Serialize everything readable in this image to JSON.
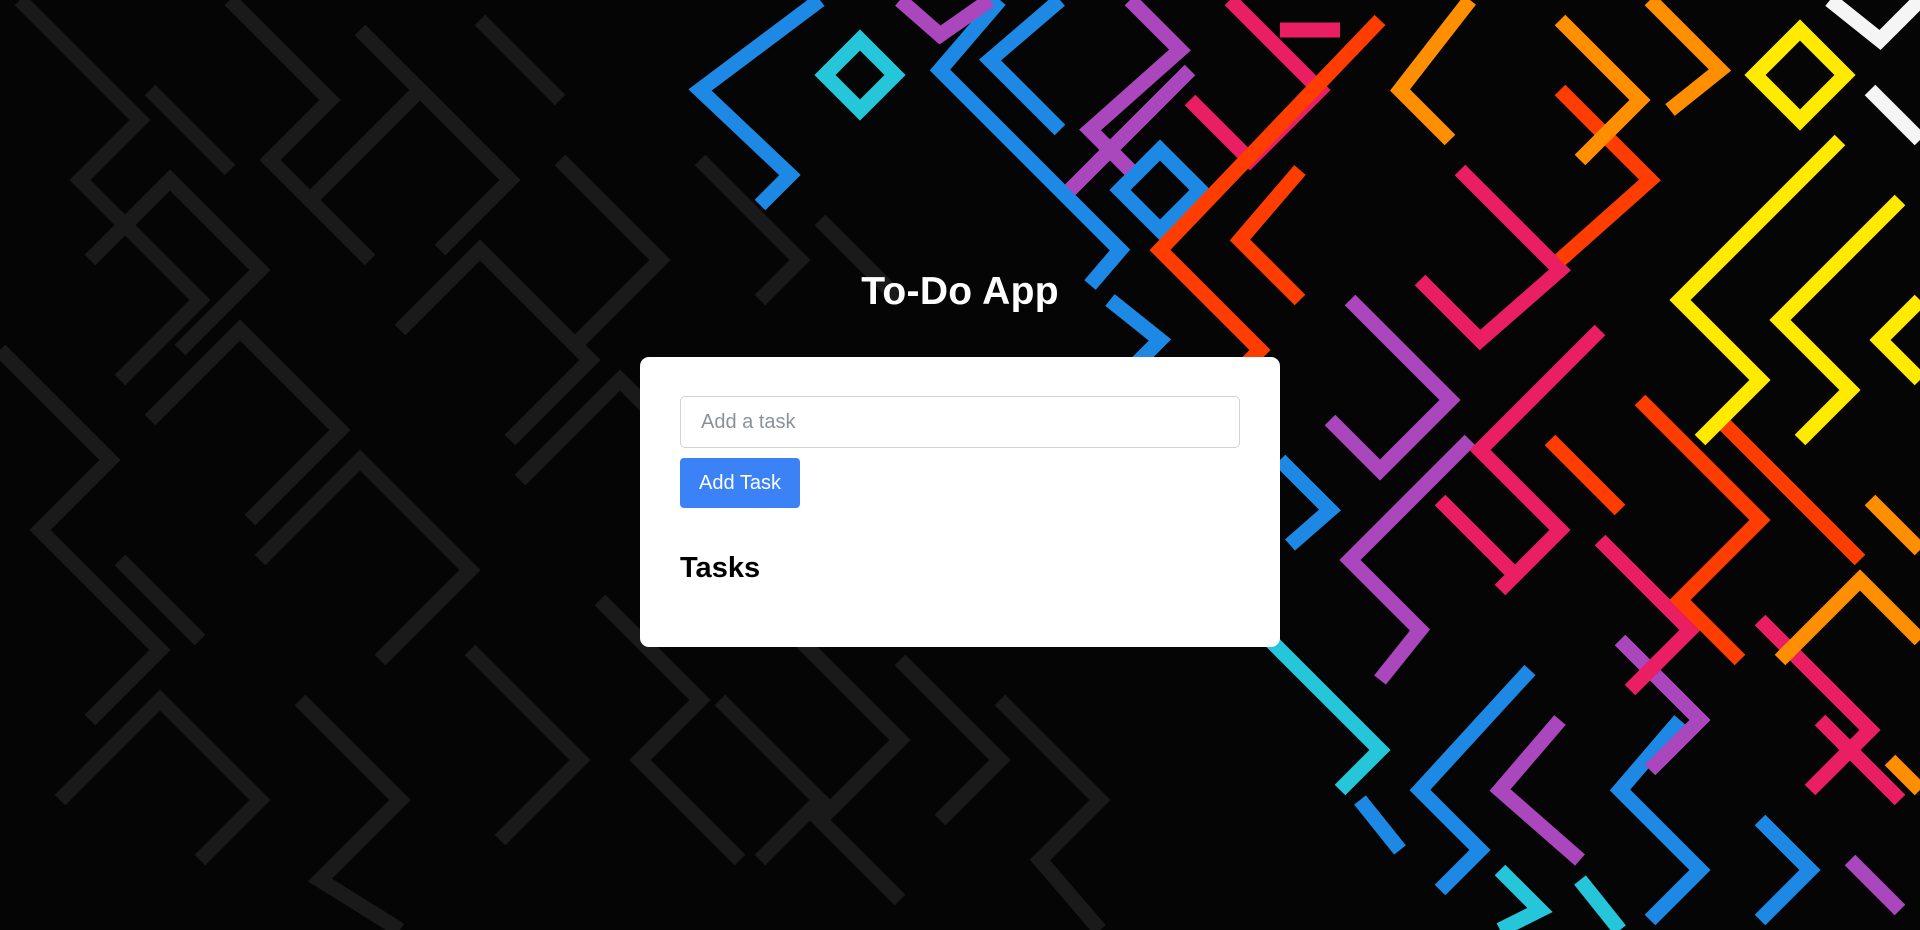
{
  "app": {
    "title": "To-Do App"
  },
  "form": {
    "input_placeholder": "Add a task",
    "input_value": "",
    "add_button_label": "Add Task"
  },
  "tasks": {
    "heading": "Tasks",
    "items": []
  },
  "colors": {
    "accent": "#3b82f6",
    "card_background": "#ffffff",
    "page_background": "#050505",
    "maze_lines": [
      "#1e88e5",
      "#ab47bc",
      "#e91e63",
      "#ff3d00",
      "#ff8f00",
      "#ffea00",
      "#26c6da",
      "#f5f5f5"
    ]
  },
  "background": {
    "pattern": "maze"
  }
}
